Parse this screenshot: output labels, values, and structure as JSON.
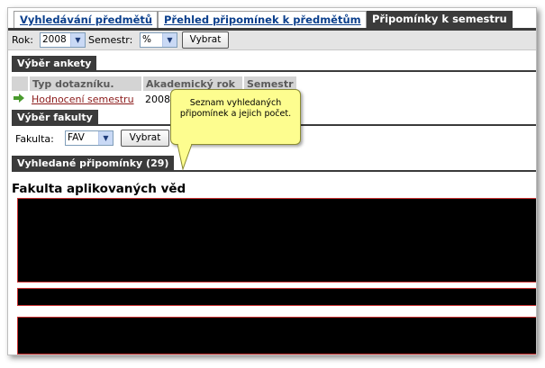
{
  "tabs": [
    {
      "label": "Vyhledávání předmětů"
    },
    {
      "label": "Přehled připomínek k předmětům"
    },
    {
      "label": "Připomínky k semestru"
    }
  ],
  "filters": {
    "year_label": "Rok:",
    "year_value": "2008",
    "semester_label": "Semestr:",
    "semester_value": "%",
    "submit_label": "Vybrat"
  },
  "survey_section": {
    "title": "Výběr ankety",
    "columns": [
      "Typ dotazníku.",
      "Akademický rok",
      "Semestr"
    ],
    "rows": [
      {
        "type": "Hodnocení semestru",
        "year": "2008",
        "semester": ""
      }
    ]
  },
  "faculty_section": {
    "title": "Výběr fakulty",
    "faculty_label": "Fakulta:",
    "faculty_value": "FAV",
    "submit_label": "Vybrat"
  },
  "results_section": {
    "title": "Vyhledané připomínky (29)",
    "faculty_name": "Fakulta aplikovaných věd"
  },
  "tooltip": {
    "text_line1": "Seznam vyhledaných",
    "text_line2": "připomínek a jejich počet."
  }
}
